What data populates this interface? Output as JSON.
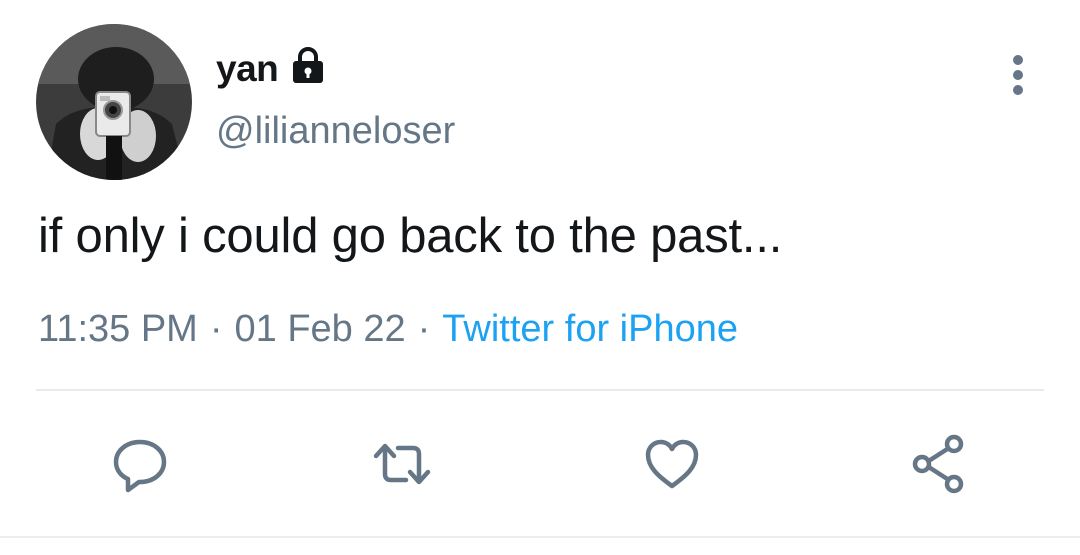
{
  "author": {
    "display_name": "yan",
    "handle": "@lilianneloser",
    "protected": true
  },
  "tweet": {
    "text": "if only i could go back to the past...",
    "time": "11:35 PM",
    "separator": "·",
    "date": "01 Feb 22",
    "source": "Twitter for iPhone"
  },
  "colors": {
    "text_primary": "#14171a",
    "text_secondary": "#657786",
    "link": "#1da1f2",
    "icon": "#657786",
    "divider": "#e6ecf0"
  },
  "icons": {
    "protected": "lock-icon",
    "more": "more-vertical-icon",
    "reply": "reply-icon",
    "retweet": "retweet-icon",
    "like": "heart-icon",
    "share": "share-icon"
  }
}
